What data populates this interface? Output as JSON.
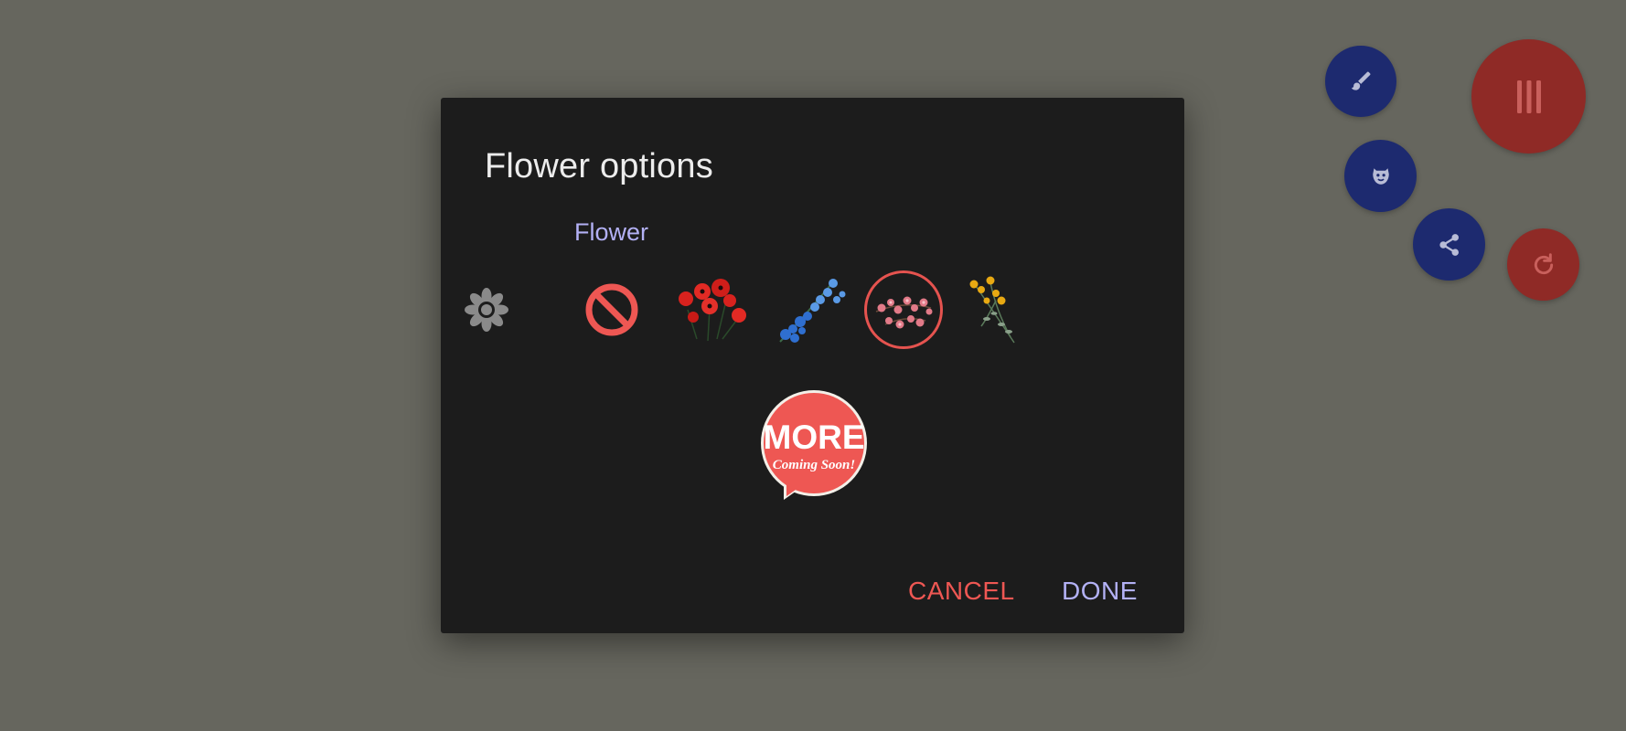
{
  "dialog": {
    "title": "Flower options",
    "section_label": "Flower",
    "options": [
      {
        "name": "none",
        "icon": "no-entry-icon",
        "selected": false
      },
      {
        "name": "red-poppies",
        "icon": "red-poppies-image",
        "selected": false
      },
      {
        "name": "blue-flowers",
        "icon": "blue-flowers-image",
        "selected": false
      },
      {
        "name": "pink-blossoms",
        "icon": "pink-blossoms-image",
        "selected": true
      },
      {
        "name": "yellow-wildflowers",
        "icon": "yellow-wildflowers-image",
        "selected": false
      }
    ],
    "more_badge": {
      "title": "MORE",
      "subtitle": "Coming Soon!"
    },
    "buttons": {
      "cancel": "CANCEL",
      "done": "DONE"
    }
  },
  "fabs": [
    {
      "name": "brush",
      "icon": "brush-icon"
    },
    {
      "name": "menu",
      "icon": "menu-lines-icon"
    },
    {
      "name": "sticker",
      "icon": "face-sticker-icon"
    },
    {
      "name": "share",
      "icon": "share-icon"
    },
    {
      "name": "reset",
      "icon": "refresh-icon"
    }
  ],
  "colors": {
    "background": "#66665e",
    "dialog": "#1c1c1c",
    "accent_red": "#ee5753",
    "accent_lavender": "#b3b1f5",
    "fab_blue": "#1d2a6f",
    "fab_red": "#8f2a26"
  }
}
